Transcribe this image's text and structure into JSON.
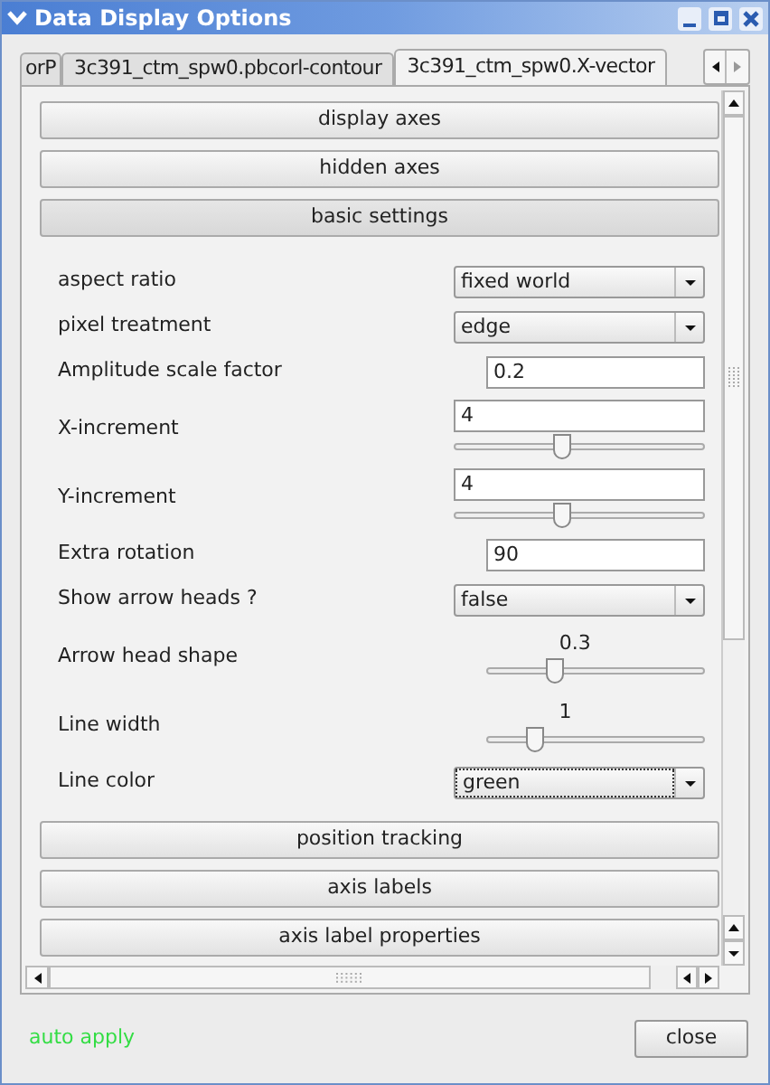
{
  "window": {
    "title": "Data Display Options"
  },
  "tabs": [
    {
      "label": "orP",
      "selected": false
    },
    {
      "label": "3c391_ctm_spw0.pbcorl-contour",
      "selected": false
    },
    {
      "label": "3c391_ctm_spw0.X-vector",
      "selected": true
    }
  ],
  "sections_top": [
    {
      "label": "display axes",
      "expanded": false
    },
    {
      "label": "hidden axes",
      "expanded": false
    },
    {
      "label": "basic settings",
      "expanded": true
    }
  ],
  "settings": [
    {
      "kind": "select",
      "label": "aspect ratio",
      "value": "fixed world",
      "focused": false
    },
    {
      "kind": "select",
      "label": "pixel treatment",
      "value": "edge",
      "focused": false
    },
    {
      "kind": "text",
      "label": "Amplitude scale factor",
      "value": "0.2"
    },
    {
      "kind": "textslider",
      "label": "X-increment",
      "value": "4",
      "level": 0.43
    },
    {
      "kind": "textslider",
      "label": "Y-increment",
      "value": "4",
      "level": 0.43
    },
    {
      "kind": "text",
      "label": "Extra rotation",
      "value": "90"
    },
    {
      "kind": "select",
      "label": "Show arrow heads ?",
      "value": "false",
      "focused": false
    },
    {
      "kind": "slider",
      "label": "Arrow head shape",
      "value": "0.3",
      "level": 0.31
    },
    {
      "kind": "slider",
      "label": "Line width",
      "value": "1",
      "level": 0.22
    },
    {
      "kind": "select",
      "label": "Line color",
      "value": "green",
      "focused": true
    }
  ],
  "sections_bottom": [
    {
      "label": "position tracking"
    },
    {
      "label": "axis labels"
    },
    {
      "label": "axis label properties"
    }
  ],
  "footer": {
    "status": "auto apply",
    "close": "close"
  }
}
